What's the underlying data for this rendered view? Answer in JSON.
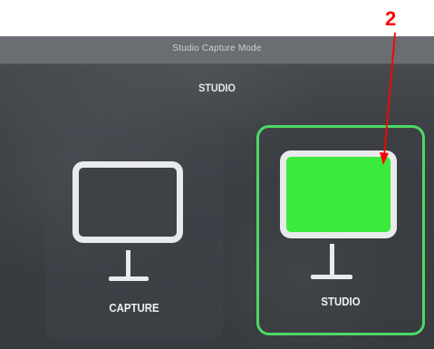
{
  "window": {
    "title": "Studio Capture Mode"
  },
  "main": {
    "heading": "STUDIO",
    "modes": [
      {
        "label": "CAPTURE",
        "selected": false
      },
      {
        "label": "STUDIO",
        "selected": true
      }
    ]
  },
  "annotation": {
    "number": "2",
    "color": "#ff0000"
  },
  "colors": {
    "selected_border": "#4cd964",
    "studio_screen": "#3cea3c"
  },
  "icons": {
    "capture_mode_icon": "monitor-icon",
    "studio_mode_icon": "monitor-icon"
  }
}
